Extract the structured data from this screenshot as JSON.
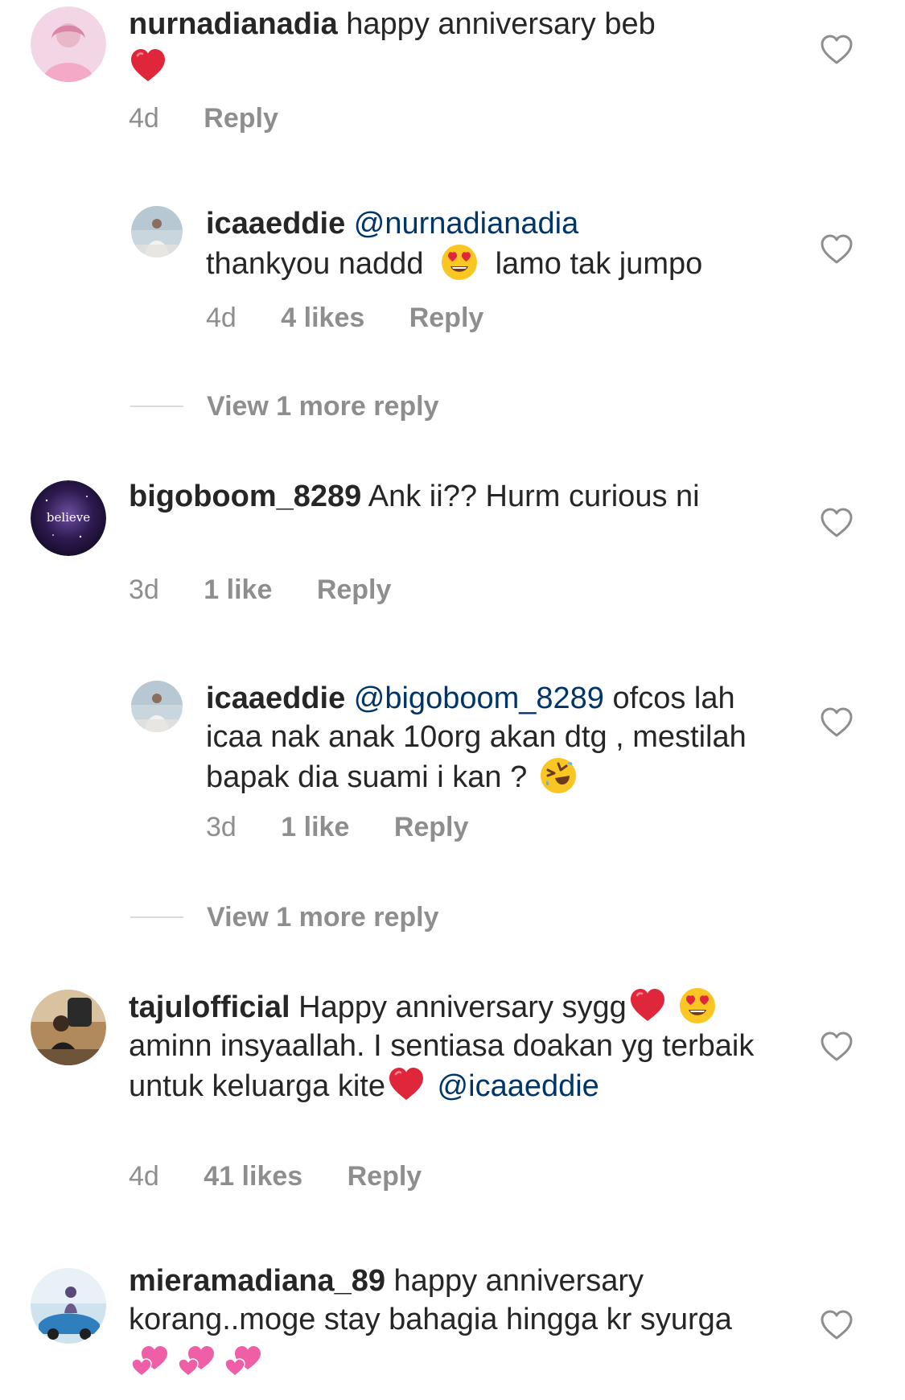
{
  "comments": [
    {
      "username": "nurnadianadia",
      "text": "happy anniversary beb",
      "time": "4d",
      "reply": "Reply"
    },
    {
      "username": "icaaeddie",
      "mention": "@nurnadianadia",
      "text_before_emoji": "thankyou naddd",
      "text_after_emoji": "lamo tak jumpo",
      "time": "4d",
      "likes": "4 likes",
      "reply": "Reply"
    },
    {
      "username": "bigoboom_8289",
      "text": "Ank ii?? Hurm curious ni",
      "avatar_text": "believe",
      "time": "3d",
      "likes": "1 like",
      "reply": "Reply"
    },
    {
      "username": "icaaeddie",
      "mention": "@bigoboom_8289",
      "text": "ofcos lah icaa nak anak 10org akan dtg , mestilah bapak dia suami i kan ?",
      "time": "3d",
      "likes": "1 like",
      "reply": "Reply"
    },
    {
      "username": "tajulofficial",
      "text_1": "Happy anniversary sygg",
      "text_2": "aminn insyaallah. I sentiasa doakan yg terbaik untuk keluarga kite",
      "mention": "@icaaeddie",
      "time": "4d",
      "likes": "41 likes",
      "reply": "Reply"
    },
    {
      "username": "mieramadiana_89",
      "text": "happy anniversary korang..moge stay bahagia hingga kr syurga"
    }
  ],
  "view_more": [
    "View 1 more reply",
    "View 1 more reply"
  ],
  "icons": {
    "like": "heart-outline-icon",
    "emoji_heart": "red-heart-emoji",
    "emoji_heart_eyes": "heart-eyes-emoji",
    "emoji_rofl": "rolling-laughing-emoji",
    "emoji_two_hearts": "two-hearts-emoji"
  },
  "colors": {
    "text": "#262626",
    "meta": "#8e8e8e",
    "mention": "#003569",
    "divider": "#dbdbdb"
  }
}
